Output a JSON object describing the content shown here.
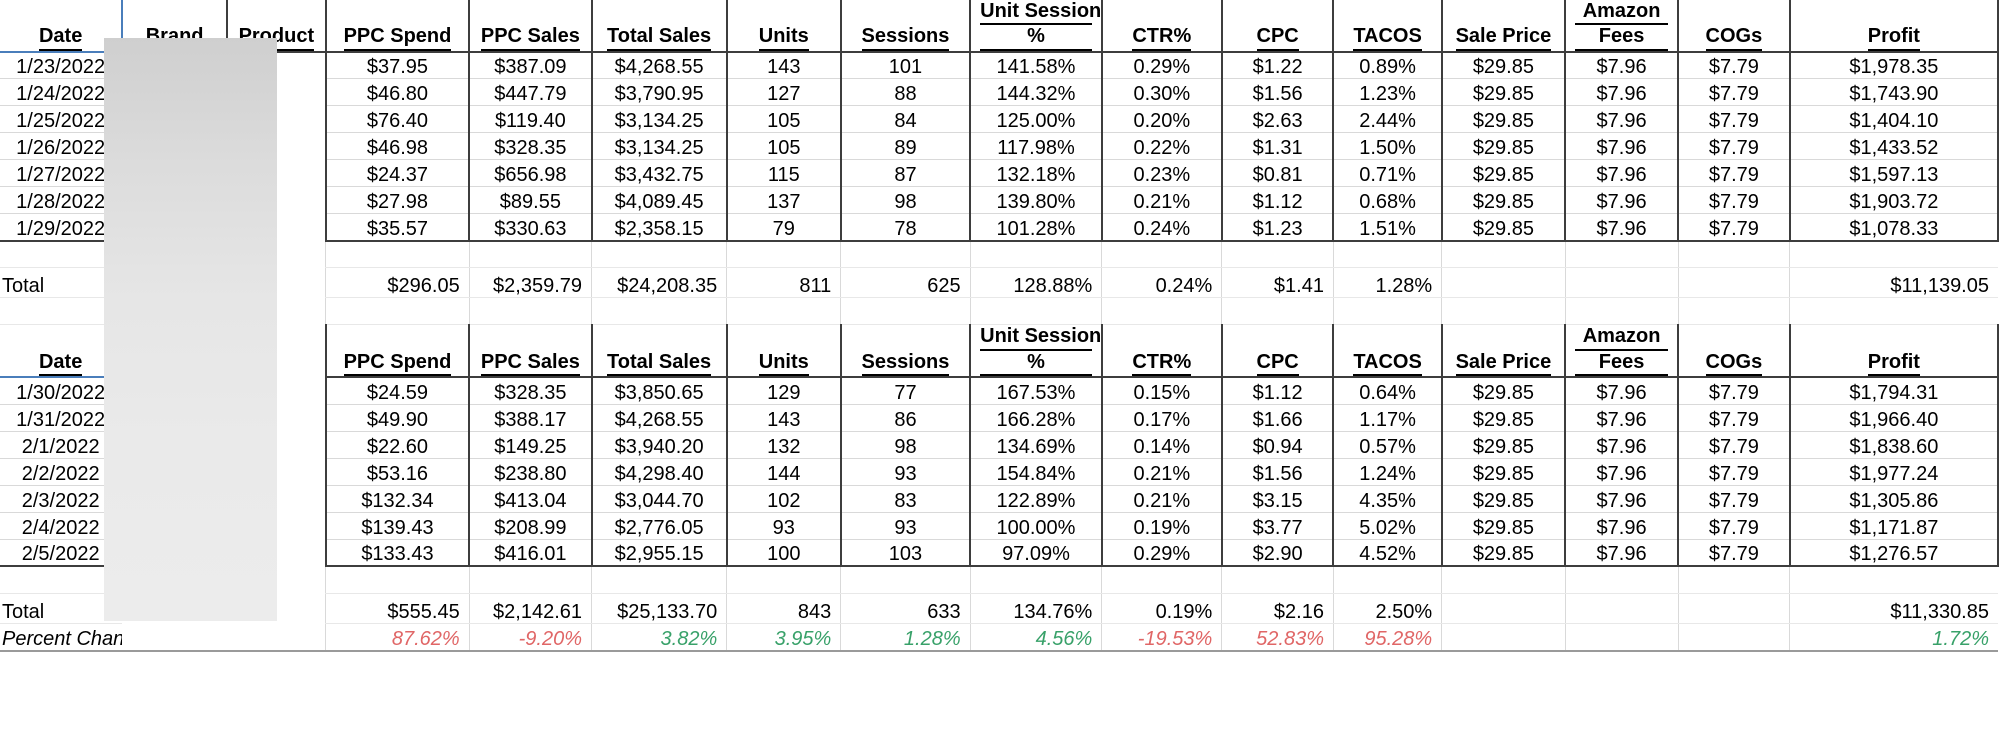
{
  "columns": [
    {
      "key": "date",
      "label": "Date",
      "label2": ""
    },
    {
      "key": "brand",
      "label": "Brand",
      "label2": ""
    },
    {
      "key": "product",
      "label": "Product",
      "label2": ""
    },
    {
      "key": "ppc_spend",
      "label": "PPC Spend",
      "label2": ""
    },
    {
      "key": "ppc_sales",
      "label": "PPC Sales",
      "label2": ""
    },
    {
      "key": "total_sales",
      "label": "Total Sales",
      "label2": ""
    },
    {
      "key": "units",
      "label": "Units",
      "label2": ""
    },
    {
      "key": "sessions",
      "label": "Sessions",
      "label2": ""
    },
    {
      "key": "usp",
      "label": "Unit Session",
      "label2": "%"
    },
    {
      "key": "ctr",
      "label": "CTR%",
      "label2": ""
    },
    {
      "key": "cpc",
      "label": "CPC",
      "label2": ""
    },
    {
      "key": "tacos",
      "label": "TACOS",
      "label2": ""
    },
    {
      "key": "sale_price",
      "label": "Sale Price",
      "label2": ""
    },
    {
      "key": "amazon_fees",
      "label": "Amazon",
      "label2": "Fees"
    },
    {
      "key": "cogs",
      "label": "COGs",
      "label2": ""
    },
    {
      "key": "profit",
      "label": "Profit",
      "label2": ""
    }
  ],
  "block1": {
    "header": {
      "date": "Date",
      "brand": "Brand",
      "product": "Product",
      "ppc_spend": "PPC Spend",
      "ppc_sales": "PPC Sales",
      "total_sales": "Total Sales",
      "units": "Units",
      "sessions": "Sessions",
      "usp_line1": "Unit Session",
      "usp_line2": "%",
      "ctr": "CTR%",
      "cpc": "CPC",
      "tacos": "TACOS",
      "sale_price": "Sale Price",
      "fees_line1": "Amazon",
      "fees_line2": "Fees",
      "cogs": "COGs",
      "profit": "Profit"
    },
    "rows": [
      {
        "date": "1/23/2022",
        "brand": "",
        "product": "",
        "ppc_spend": "$37.95",
        "ppc_sales": "$387.09",
        "total_sales": "$4,268.55",
        "units": "143",
        "sessions": "101",
        "usp": "141.58%",
        "ctr": "0.29%",
        "cpc": "$1.22",
        "tacos": "0.89%",
        "sale_price": "$29.85",
        "amazon_fees": "$7.96",
        "cogs": "$7.79",
        "profit": "$1,978.35"
      },
      {
        "date": "1/24/2022",
        "brand": "",
        "product": "",
        "ppc_spend": "$46.80",
        "ppc_sales": "$447.79",
        "total_sales": "$3,790.95",
        "units": "127",
        "sessions": "88",
        "usp": "144.32%",
        "ctr": "0.30%",
        "cpc": "$1.56",
        "tacos": "1.23%",
        "sale_price": "$29.85",
        "amazon_fees": "$7.96",
        "cogs": "$7.79",
        "profit": "$1,743.90"
      },
      {
        "date": "1/25/2022",
        "brand": "",
        "product": "",
        "ppc_spend": "$76.40",
        "ppc_sales": "$119.40",
        "total_sales": "$3,134.25",
        "units": "105",
        "sessions": "84",
        "usp": "125.00%",
        "ctr": "0.20%",
        "cpc": "$2.63",
        "tacos": "2.44%",
        "sale_price": "$29.85",
        "amazon_fees": "$7.96",
        "cogs": "$7.79",
        "profit": "$1,404.10"
      },
      {
        "date": "1/26/2022",
        "brand": "",
        "product": "",
        "ppc_spend": "$46.98",
        "ppc_sales": "$328.35",
        "total_sales": "$3,134.25",
        "units": "105",
        "sessions": "89",
        "usp": "117.98%",
        "ctr": "0.22%",
        "cpc": "$1.31",
        "tacos": "1.50%",
        "sale_price": "$29.85",
        "amazon_fees": "$7.96",
        "cogs": "$7.79",
        "profit": "$1,433.52"
      },
      {
        "date": "1/27/2022",
        "brand": "",
        "product": "",
        "ppc_spend": "$24.37",
        "ppc_sales": "$656.98",
        "total_sales": "$3,432.75",
        "units": "115",
        "sessions": "87",
        "usp": "132.18%",
        "ctr": "0.23%",
        "cpc": "$0.81",
        "tacos": "0.71%",
        "sale_price": "$29.85",
        "amazon_fees": "$7.96",
        "cogs": "$7.79",
        "profit": "$1,597.13"
      },
      {
        "date": "1/28/2022",
        "brand": "",
        "product": "",
        "ppc_spend": "$27.98",
        "ppc_sales": "$89.55",
        "total_sales": "$4,089.45",
        "units": "137",
        "sessions": "98",
        "usp": "139.80%",
        "ctr": "0.21%",
        "cpc": "$1.12",
        "tacos": "0.68%",
        "sale_price": "$29.85",
        "amazon_fees": "$7.96",
        "cogs": "$7.79",
        "profit": "$1,903.72"
      },
      {
        "date": "1/29/2022",
        "brand": "",
        "product": "",
        "ppc_spend": "$35.57",
        "ppc_sales": "$330.63",
        "total_sales": "$2,358.15",
        "units": "79",
        "sessions": "78",
        "usp": "101.28%",
        "ctr": "0.24%",
        "cpc": "$1.23",
        "tacos": "1.51%",
        "sale_price": "$29.85",
        "amazon_fees": "$7.96",
        "cogs": "$7.79",
        "profit": "$1,078.33"
      }
    ],
    "total": {
      "label": "Total",
      "brand": "",
      "product": "",
      "ppc_spend": "$296.05",
      "ppc_sales": "$2,359.79",
      "total_sales": "$24,208.35",
      "units": "811",
      "sessions": "625",
      "usp": "128.88%",
      "ctr": "0.24%",
      "cpc": "$1.41",
      "tacos": "1.28%",
      "sale_price": "",
      "amazon_fees": "",
      "cogs": "",
      "profit": "$11,139.05"
    }
  },
  "block2": {
    "header": {
      "date": "Date",
      "brand": "",
      "product": "",
      "ppc_spend": "PPC Spend",
      "ppc_sales": "PPC Sales",
      "total_sales": "Total Sales",
      "units": "Units",
      "sessions": "Sessions",
      "usp_line1": "Unit Session",
      "usp_line2": "%",
      "ctr": "CTR%",
      "cpc": "CPC",
      "tacos": "TACOS",
      "sale_price": "Sale Price",
      "fees_line1": "Amazon",
      "fees_line2": "Fees",
      "cogs": "COGs",
      "profit": "Profit"
    },
    "rows": [
      {
        "date": "1/30/2022",
        "brand": "",
        "product": "",
        "ppc_spend": "$24.59",
        "ppc_sales": "$328.35",
        "total_sales": "$3,850.65",
        "units": "129",
        "sessions": "77",
        "usp": "167.53%",
        "ctr": "0.15%",
        "cpc": "$1.12",
        "tacos": "0.64%",
        "sale_price": "$29.85",
        "amazon_fees": "$7.96",
        "cogs": "$7.79",
        "profit": "$1,794.31"
      },
      {
        "date": "1/31/2022",
        "brand": "",
        "product": "",
        "ppc_spend": "$49.90",
        "ppc_sales": "$388.17",
        "total_sales": "$4,268.55",
        "units": "143",
        "sessions": "86",
        "usp": "166.28%",
        "ctr": "0.17%",
        "cpc": "$1.66",
        "tacos": "1.17%",
        "sale_price": "$29.85",
        "amazon_fees": "$7.96",
        "cogs": "$7.79",
        "profit": "$1,966.40"
      },
      {
        "date": "2/1/2022",
        "brand": "",
        "product": "",
        "ppc_spend": "$22.60",
        "ppc_sales": "$149.25",
        "total_sales": "$3,940.20",
        "units": "132",
        "sessions": "98",
        "usp": "134.69%",
        "ctr": "0.14%",
        "cpc": "$0.94",
        "tacos": "0.57%",
        "sale_price": "$29.85",
        "amazon_fees": "$7.96",
        "cogs": "$7.79",
        "profit": "$1,838.60"
      },
      {
        "date": "2/2/2022",
        "brand": "",
        "product": "",
        "ppc_spend": "$53.16",
        "ppc_sales": "$238.80",
        "total_sales": "$4,298.40",
        "units": "144",
        "sessions": "93",
        "usp": "154.84%",
        "ctr": "0.21%",
        "cpc": "$1.56",
        "tacos": "1.24%",
        "sale_price": "$29.85",
        "amazon_fees": "$7.96",
        "cogs": "$7.79",
        "profit": "$1,977.24"
      },
      {
        "date": "2/3/2022",
        "brand": "",
        "product": "",
        "ppc_spend": "$132.34",
        "ppc_sales": "$413.04",
        "total_sales": "$3,044.70",
        "units": "102",
        "sessions": "83",
        "usp": "122.89%",
        "ctr": "0.21%",
        "cpc": "$3.15",
        "tacos": "4.35%",
        "sale_price": "$29.85",
        "amazon_fees": "$7.96",
        "cogs": "$7.79",
        "profit": "$1,305.86"
      },
      {
        "date": "2/4/2022",
        "brand": "",
        "product": "",
        "ppc_spend": "$139.43",
        "ppc_sales": "$208.99",
        "total_sales": "$2,776.05",
        "units": "93",
        "sessions": "93",
        "usp": "100.00%",
        "ctr": "0.19%",
        "cpc": "$3.77",
        "tacos": "5.02%",
        "sale_price": "$29.85",
        "amazon_fees": "$7.96",
        "cogs": "$7.79",
        "profit": "$1,171.87"
      },
      {
        "date": "2/5/2022",
        "brand": "",
        "product": "",
        "ppc_spend": "$133.43",
        "ppc_sales": "$416.01",
        "total_sales": "$2,955.15",
        "units": "100",
        "sessions": "103",
        "usp": "97.09%",
        "ctr": "0.29%",
        "cpc": "$2.90",
        "tacos": "4.52%",
        "sale_price": "$29.85",
        "amazon_fees": "$7.96",
        "cogs": "$7.79",
        "profit": "$1,276.57"
      }
    ],
    "total": {
      "label": "Total",
      "brand": "",
      "product": "",
      "ppc_spend": "$555.45",
      "ppc_sales": "$2,142.61",
      "total_sales": "$25,133.70",
      "units": "843",
      "sessions": "633",
      "usp": "134.76%",
      "ctr": "0.19%",
      "cpc": "$2.16",
      "tacos": "2.50%",
      "sale_price": "",
      "amazon_fees": "",
      "cogs": "",
      "profit": "$11,330.85"
    },
    "percent_change": {
      "label": "Percent Change",
      "brand": "",
      "product": "",
      "ppc_spend": "87.62%",
      "ppc_sales": "-9.20%",
      "total_sales": "3.82%",
      "units": "3.95%",
      "sessions": "1.28%",
      "usp": "4.56%",
      "ctr": "-19.53%",
      "cpc": "52.83%",
      "tacos": "95.28%",
      "sale_price": "",
      "amazon_fees": "",
      "cogs": "",
      "profit": "1.72%"
    }
  },
  "colors": {
    "negative": "#e06666",
    "positive": "#38a169",
    "grid_line": "#d9d9d9",
    "border_dark": "#3d3d3d",
    "selection_blue": "#4a7ebb",
    "redaction_top": "#cfcfcf",
    "redaction_bottom": "#ececec"
  }
}
